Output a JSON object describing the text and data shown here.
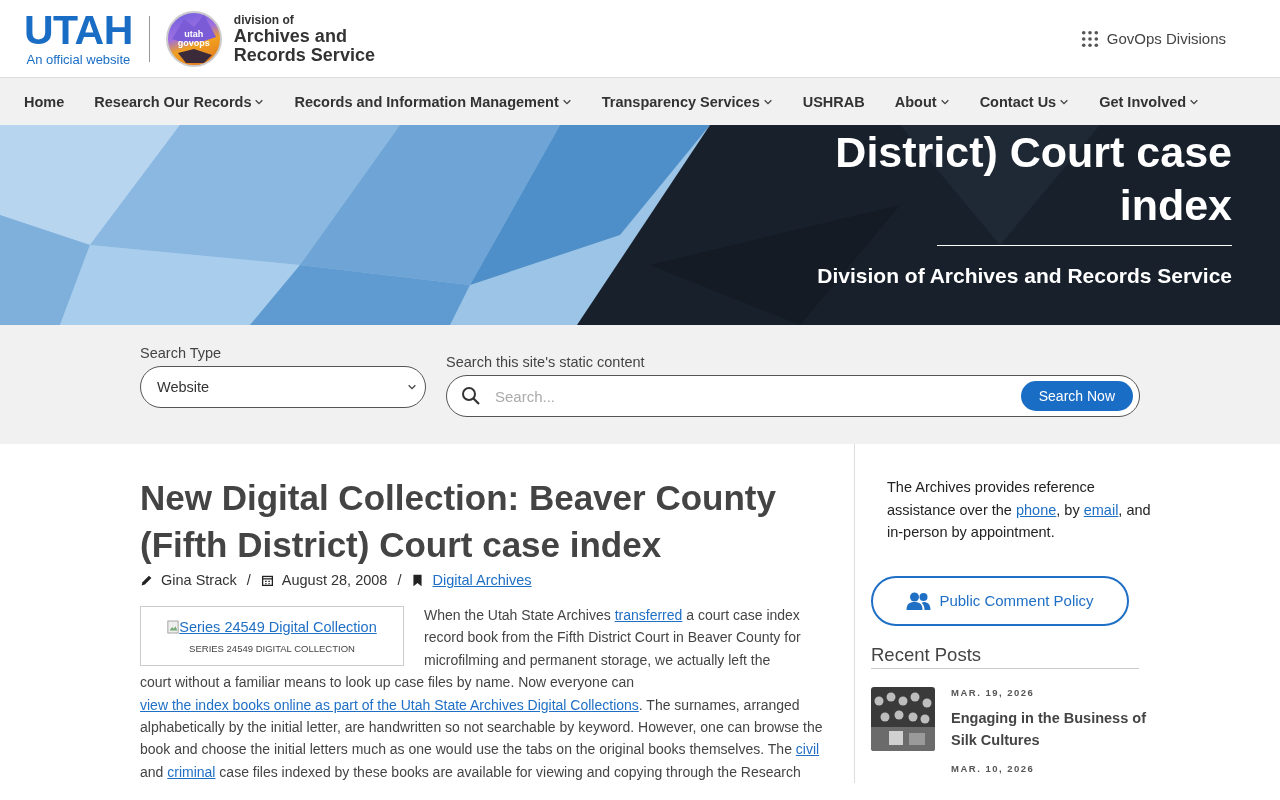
{
  "header": {
    "logo_word": "UTAH",
    "logo_tagline": "An official website",
    "badge_lines": [
      "utah",
      "govops"
    ],
    "division_prefix": "division of",
    "division_name": "Archives and Records Service",
    "divisions_link": "GovOps Divisions"
  },
  "nav": [
    {
      "label": "Home",
      "dropdown": false
    },
    {
      "label": "Research Our Records",
      "dropdown": true
    },
    {
      "label": "Records and Information Management",
      "dropdown": true
    },
    {
      "label": "Transparency Services",
      "dropdown": true
    },
    {
      "label": "USHRAB",
      "dropdown": false
    },
    {
      "label": "About",
      "dropdown": true
    },
    {
      "label": "Contact Us",
      "dropdown": true
    },
    {
      "label": "Get Involved",
      "dropdown": true
    }
  ],
  "hero": {
    "title": "District) Court case index",
    "subtitle": "Division of Archives and Records Service"
  },
  "search": {
    "type_label": "Search Type",
    "type_value": "Website",
    "query_label": "Search this site's static content",
    "placeholder": "Search...",
    "button": "Search Now"
  },
  "article": {
    "title": "New Digital Collection: Beaver County (Fifth District) Court case index",
    "meta": [
      {
        "kind": "author",
        "text": "Gina Strack"
      },
      {
        "kind": "separator",
        "text": "/"
      },
      {
        "kind": "date",
        "text": "August 28, 2008"
      },
      {
        "kind": "separator",
        "text": "/"
      },
      {
        "kind": "category",
        "text": "Digital Archives"
      }
    ],
    "figure": {
      "alt": "Series 24549 Digital Collection",
      "caption": "SERIES 24549 DIGITAL COLLECTION"
    },
    "body_beside_image": [
      {
        "kind": "text",
        "text": "When the Utah State Archives "
      },
      {
        "kind": "link",
        "text": "transferred"
      },
      {
        "kind": "text",
        "text": " a court case index record book from the Fifth District Court in Beaver County for microfilming and permanent storage, we actually left the"
      }
    ],
    "body": [
      {
        "kind": "text",
        "text": "court without a familiar means to look up case files by name. Now everyone can "
      },
      {
        "kind": "link",
        "text": "view the index books online as part of the Utah State Archives Digital Collections"
      },
      {
        "kind": "text",
        "text": ". The surnames, arranged alphabetically by the initial letter, are handwritten so not searchable by keyword. However, one can browse the book and choose the initial letters much as one would use the tabs on the original books themselves. The "
      },
      {
        "kind": "link",
        "text": "civil"
      },
      {
        "kind": "text",
        "text": " and "
      },
      {
        "kind": "link",
        "text": "criminal"
      },
      {
        "kind": "text",
        "text": " case files indexed by these books are available for viewing and copying through the Research"
      }
    ]
  },
  "sidebar": {
    "note": [
      {
        "kind": "text",
        "text": "The Archives provides reference assistance over the "
      },
      {
        "kind": "link",
        "text": "phone"
      },
      {
        "kind": "text",
        "text": ", by "
      },
      {
        "kind": "link",
        "text": "email"
      },
      {
        "kind": "text",
        "text": ", and in-person by appointment."
      }
    ],
    "policy_button": "Public Comment Policy",
    "recent_heading": "Recent Posts",
    "recent_posts": [
      {
        "date": "MAR. 19, 2026",
        "title": "Engaging in the Business of Silk Cultures"
      },
      {
        "date": "MAR. 10, 2026"
      }
    ]
  }
}
